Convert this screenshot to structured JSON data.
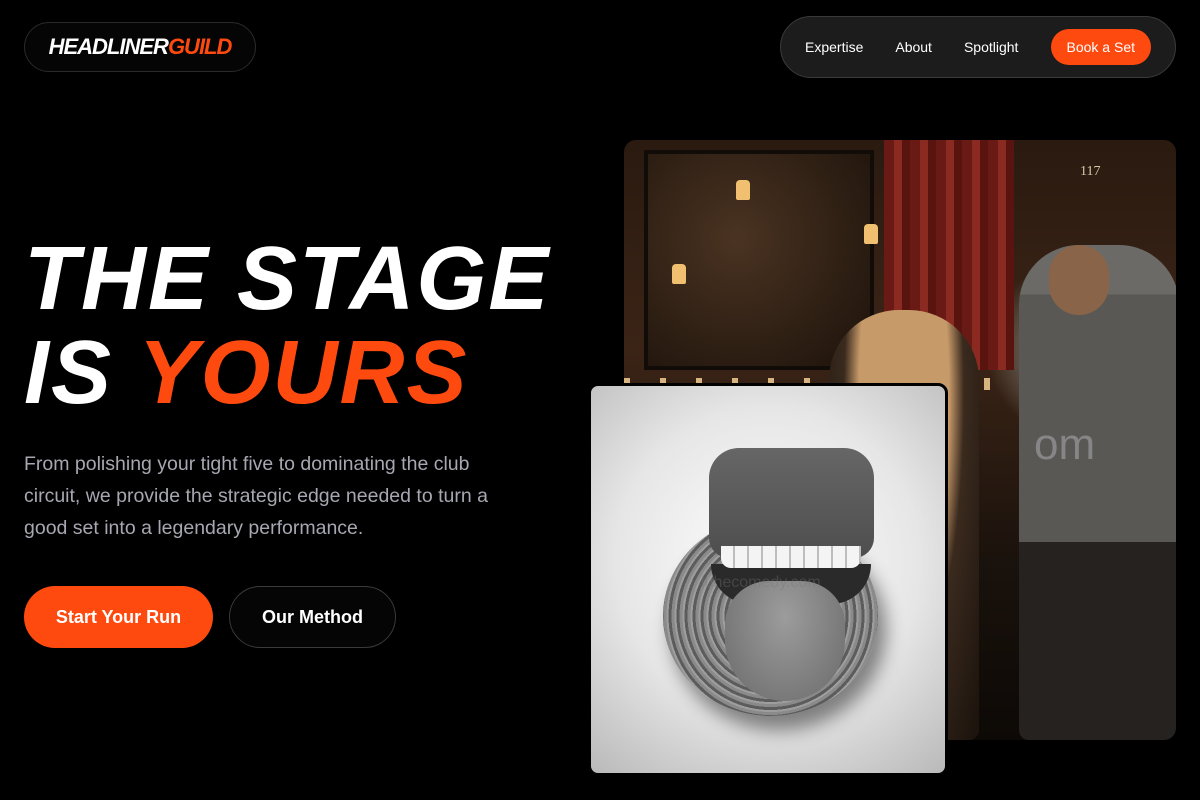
{
  "brand": {
    "logo_part1": "HEADLINER",
    "logo_part2": "GUILD",
    "accent_color": "#ff4a0f"
  },
  "nav": {
    "links": [
      "Expertise",
      "About",
      "Spotlight"
    ],
    "cta_label": "Book a Set"
  },
  "hero": {
    "title_line1": "THE STAGE",
    "title_line2_plain": "IS ",
    "title_line2_accent": "YOURS",
    "subtitle": "From polishing your tight five to dominating the club circuit, we provide the strategic edge needed to turn a good set into a legendary performance.",
    "primary_cta": "Start Your Run",
    "secondary_cta": "Our Method"
  },
  "images": {
    "back_door_number": "117",
    "back_watermark": "om",
    "front_watermark": "luhecomedy.com"
  }
}
